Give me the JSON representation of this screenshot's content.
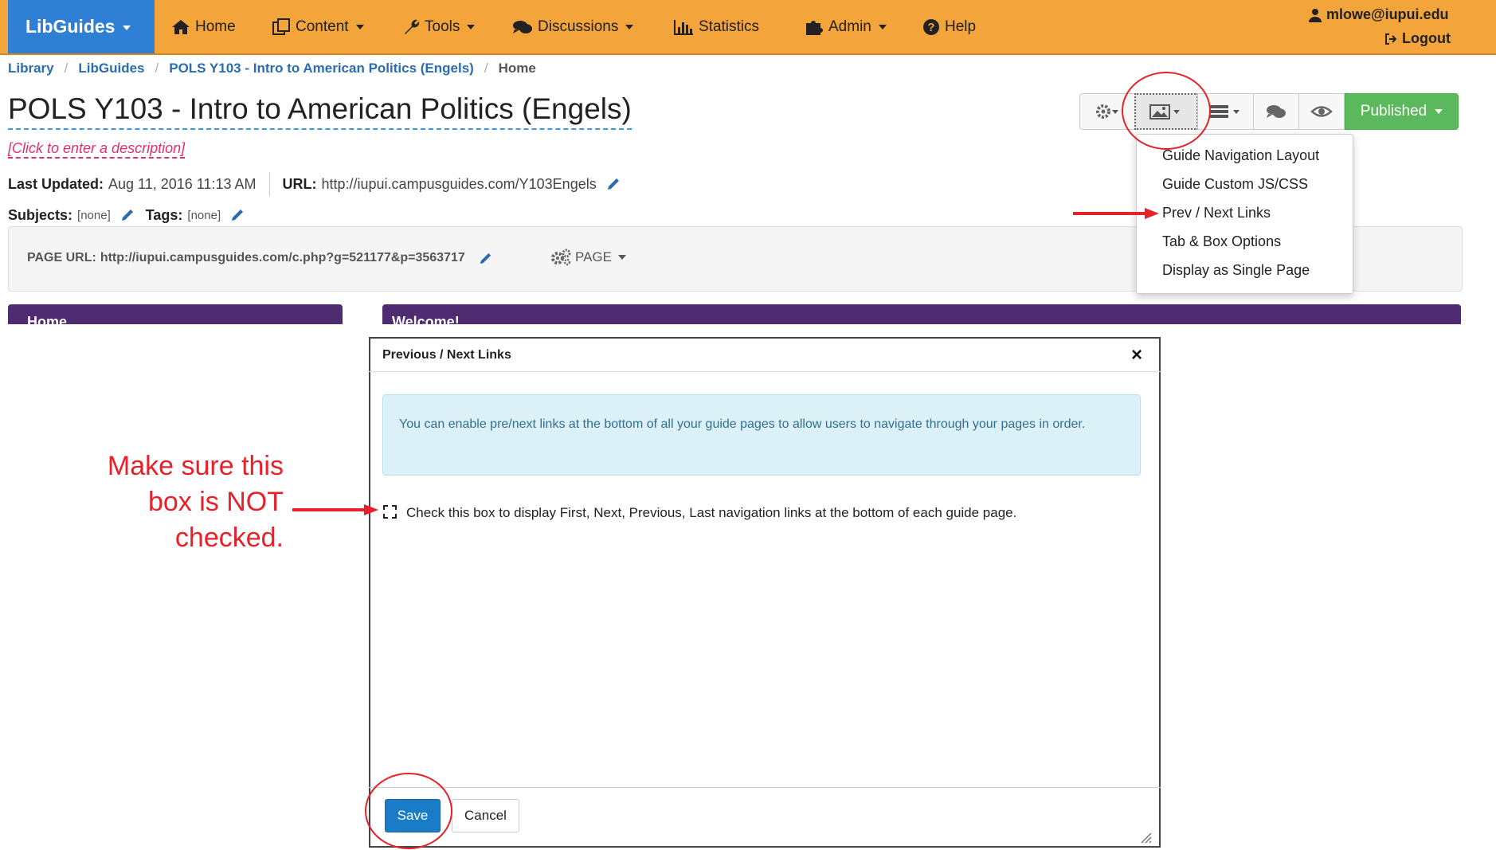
{
  "nav": {
    "brand": "LibGuides",
    "items": [
      {
        "label": "Home",
        "icon": "home-icon"
      },
      {
        "label": "Content",
        "icon": "content-icon"
      },
      {
        "label": "Tools",
        "icon": "wrench-icon"
      },
      {
        "label": "Discussions",
        "icon": "chat-icon"
      },
      {
        "label": "Statistics",
        "icon": "bar-chart-icon"
      },
      {
        "label": "Admin",
        "icon": "puzzle-icon"
      },
      {
        "label": "Help",
        "icon": "help-icon"
      }
    ],
    "user": "mlowe@iupui.edu",
    "logout": "Logout"
  },
  "breadcrumb": {
    "items": [
      "Library",
      "LibGuides",
      "POLS Y103 - Intro to American Politics (Engels)"
    ],
    "current": "Home",
    "separator": "/"
  },
  "guide": {
    "title": "POLS Y103 - Intro to American Politics (Engels)",
    "description_placeholder": "[Click to enter a description]",
    "last_updated_label": "Last Updated:",
    "last_updated": "Aug 11, 2016 11:13 AM",
    "url_label": "URL:",
    "url": "http://iupui.campusguides.com/Y103Engels",
    "subjects_label": "Subjects:",
    "subjects": "[none]",
    "tags_label": "Tags:",
    "tags": "[none]"
  },
  "page_panel": {
    "url_label": "PAGE URL:",
    "url": "http://iupui.campusguides.com/c.php?g=521177&p=3563717",
    "page_menu": "PAGE"
  },
  "toolbar": {
    "publish_label": "Published"
  },
  "dropdown": {
    "items": [
      "Guide Navigation Layout",
      "Guide Custom JS/CSS",
      "Prev / Next Links",
      "Tab & Box Options",
      "Display as Single Page"
    ]
  },
  "boxes": {
    "left_title": "Home",
    "right_title": "Welcome!"
  },
  "modal": {
    "title": "Previous / Next Links",
    "close": "×",
    "info": "You can enable pre/next links at the bottom of all your guide pages to allow users to navigate through your pages in order.",
    "checkbox_label": "Check this box to display First, Next, Previous, Last navigation links at the bottom of each guide page.",
    "checkbox_checked": false,
    "save_label": "Save",
    "cancel_label": "Cancel"
  },
  "annotation": {
    "lines": [
      "Make sure this",
      "box is NOT",
      "checked."
    ]
  },
  "colors": {
    "navbar": "#f3a43a",
    "brand": "#2f7fd5",
    "publish": "#5cb85c",
    "box_header": "#4f2b71",
    "annotation": "#e8202a",
    "info_box": "#dcf0f7",
    "save": "#1a7bc6"
  }
}
